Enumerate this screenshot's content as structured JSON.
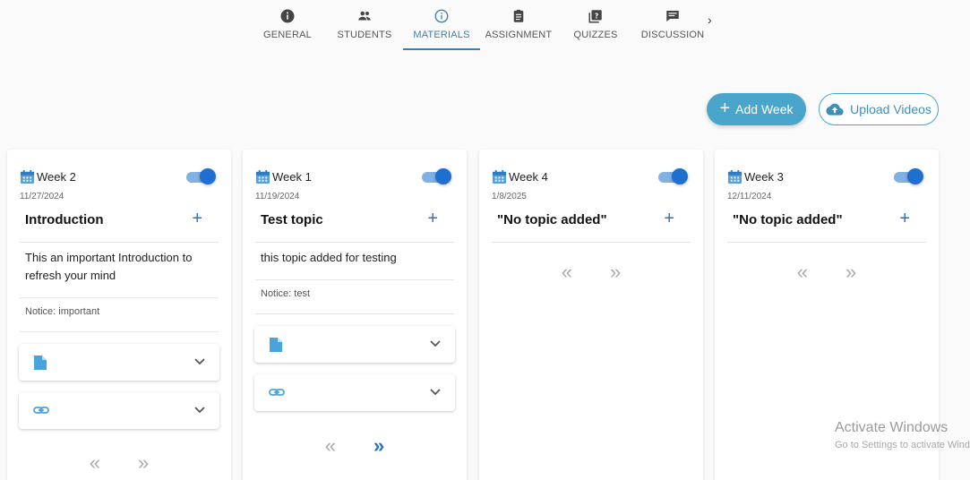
{
  "tabs": [
    {
      "label": "GENERAL",
      "icon": "info-filled-icon"
    },
    {
      "label": "STUDENTS",
      "icon": "people-icon"
    },
    {
      "label": "MATERIALS",
      "icon": "info-outline-icon",
      "active": true
    },
    {
      "label": "ASSIGNMENT",
      "icon": "clipboard-icon"
    },
    {
      "label": "QUIZZES",
      "icon": "quiz-icon"
    },
    {
      "label": "DISCUSSION",
      "icon": "chat-icon"
    }
  ],
  "tabs_next_label": "›",
  "actions": {
    "add_week": "Add Week",
    "add_icon": "+",
    "upload_videos": "Upload Videos"
  },
  "cards": [
    {
      "week": "Week 2",
      "date": "11/27/2024",
      "topic": "Introduction",
      "description": "This an important Introduction to refresh your mind",
      "notice": "Notice: important",
      "enabled": true
    },
    {
      "week": "Week 1",
      "date": "11/19/2024",
      "topic": "Test topic",
      "description": "this topic added for testing",
      "notice": "Notice: test",
      "enabled": true
    },
    {
      "week": "Week 4",
      "date": "1/8/2025",
      "topic": "\"No topic added\"",
      "enabled": true
    },
    {
      "week": "Week 3",
      "date": "12/11/2024",
      "topic": "\"No topic added\"",
      "enabled": true
    }
  ],
  "pager": {
    "prev": "«",
    "next": "»"
  },
  "topic_add": "+",
  "watermark": {
    "title": "Activate Windows",
    "subtitle": "Go to Settings to activate Windows."
  },
  "colors": {
    "accent": "#3d7fa9",
    "button": "#4aa5cb",
    "toggle": "#1f6fd1"
  }
}
